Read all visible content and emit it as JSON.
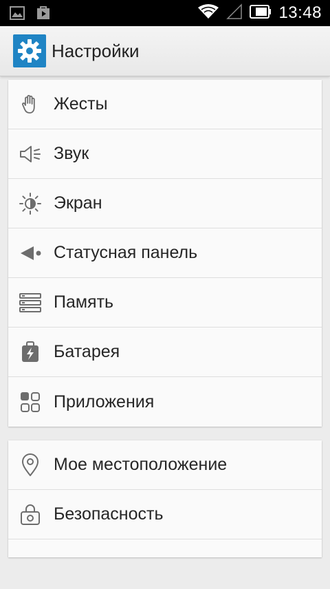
{
  "status_bar": {
    "time": "13:48",
    "left_icons": [
      "gallery-icon",
      "play-store-icon"
    ],
    "right_icons": [
      "wifi-icon",
      "signal-icon",
      "battery-icon"
    ]
  },
  "action_bar": {
    "title": "Настройки",
    "icon": "settings-gear-icon",
    "icon_color": "#1f84c4"
  },
  "groups": [
    {
      "items": [
        {
          "label": "Жесты",
          "icon": "hand-icon"
        },
        {
          "label": "Звук",
          "icon": "speaker-icon"
        },
        {
          "label": "Экран",
          "icon": "brightness-icon"
        },
        {
          "label": "Статусная панель",
          "icon": "status-panel-icon"
        },
        {
          "label": "Память",
          "icon": "storage-icon"
        },
        {
          "label": "Батарея",
          "icon": "battery-icon"
        },
        {
          "label": "Приложения",
          "icon": "apps-icon"
        }
      ]
    },
    {
      "items": [
        {
          "label": "Мое местоположение",
          "icon": "location-icon"
        },
        {
          "label": "Безопасность",
          "icon": "lock-icon"
        }
      ]
    }
  ]
}
